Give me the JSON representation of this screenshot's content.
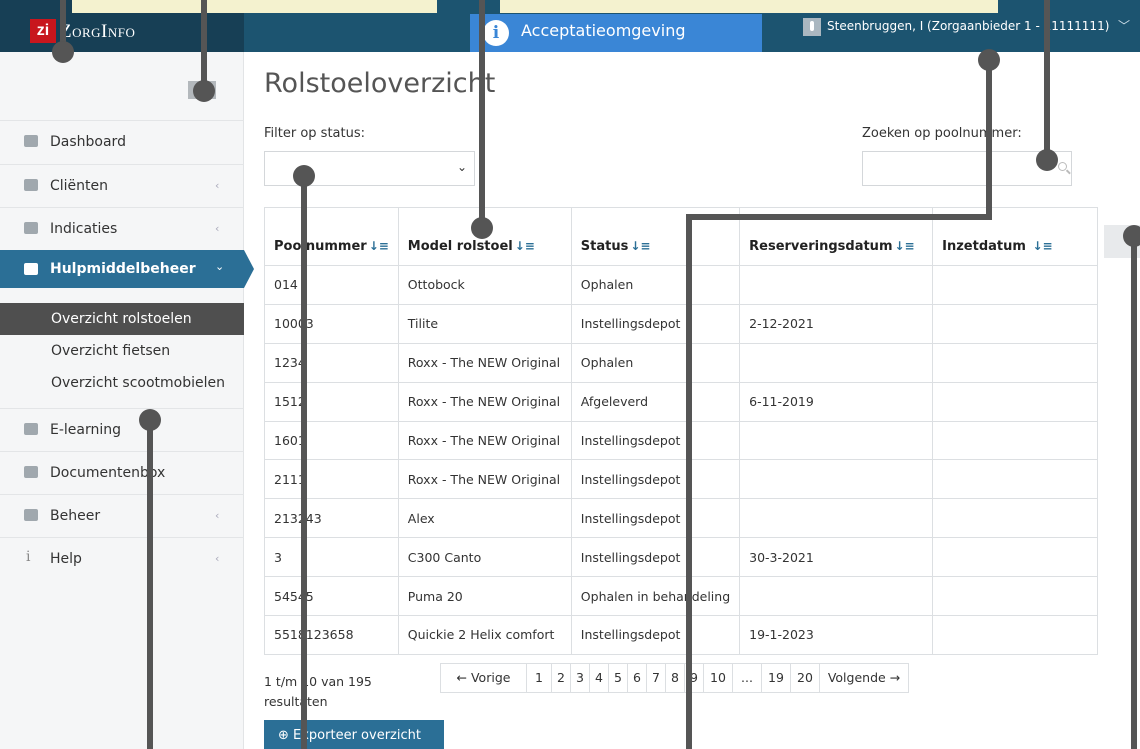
{
  "header": {
    "logo_mark": "zi",
    "logo_text": "ZorgInfo",
    "environment_icon": "i",
    "environment": "Acceptatieomgeving",
    "user": "Steenbruggen, I (Zorgaanbieder 1 - 11111111)",
    "user_caret": "﹀"
  },
  "sidebar": {
    "items": [
      {
        "label": "Dashboard",
        "icon": "home-icon",
        "chevron": ""
      },
      {
        "label": "Cliënten",
        "icon": "users-icon",
        "chevron": "‹"
      },
      {
        "label": "Indicaties",
        "icon": "briefcase-icon",
        "chevron": "‹"
      },
      {
        "label": "Hulpmiddelbeheer",
        "icon": "ambulance-icon",
        "chevron": "⌄"
      },
      {
        "label": "E-learning",
        "icon": "book-icon",
        "chevron": ""
      },
      {
        "label": "Documentenbox",
        "icon": "archive-icon",
        "chevron": ""
      },
      {
        "label": "Beheer",
        "icon": "gears-icon",
        "chevron": "‹"
      },
      {
        "label": "Help",
        "icon": "info-icon",
        "chevron": "‹"
      }
    ],
    "sub_items": [
      "Overzicht rolstoelen",
      "Overzicht fietsen",
      "Overzicht scootmobielen"
    ]
  },
  "main": {
    "title": "Rolstoeloverzicht",
    "filter_label": "Filter op status:",
    "filter_value": "",
    "filter_chevron": "⌄",
    "search_label": "Zoeken op poolnummer:",
    "search_value": ""
  },
  "table": {
    "sort_icon": "↓≡",
    "columns": [
      "Poolnummer",
      "Model rolstoel",
      "Status",
      "Reserveringsdatum",
      "Inzetdatum "
    ],
    "rows": [
      [
        "014",
        "Ottobock",
        "Ophalen",
        "",
        ""
      ],
      [
        "10003",
        "Tilite",
        "Instellingsdepot",
        "2-12-2021",
        ""
      ],
      [
        "1234",
        "Roxx - The NEW Original",
        "Ophalen",
        "",
        ""
      ],
      [
        "1512",
        "Roxx - The NEW Original",
        "Afgeleverd",
        "6-11-2019",
        ""
      ],
      [
        "1601",
        "Roxx - The NEW Original",
        "Instellingsdepot",
        "",
        ""
      ],
      [
        "2111",
        "Roxx - The NEW Original",
        "Instellingsdepot",
        "",
        ""
      ],
      [
        "213243",
        "Alex",
        "Instellingsdepot",
        "",
        ""
      ],
      [
        "3",
        "C300 Canto",
        "Instellingsdepot",
        "30-3-2021",
        ""
      ],
      [
        "54545",
        "Puma 20",
        "Ophalen in behandeling",
        "",
        ""
      ],
      [
        "5518123658",
        "Quickie 2 Helix comfort",
        "Instellingsdepot",
        "19-1-2023",
        ""
      ]
    ]
  },
  "pagination": {
    "summary": "1 t/m 10 van 195 resultaten",
    "prev": "← Vorige",
    "pages": [
      "1",
      "2",
      "3",
      "4",
      "5",
      "6",
      "7",
      "8",
      "9",
      "10",
      "...",
      "19",
      "20"
    ],
    "next": "Volgende →"
  },
  "export_label": "⊕ Exporteer overzicht",
  "colors": {
    "topbar": "#1c5470",
    "accent": "#2b6f96",
    "environment": "#3a86d6",
    "logo_red": "#c8161d"
  }
}
